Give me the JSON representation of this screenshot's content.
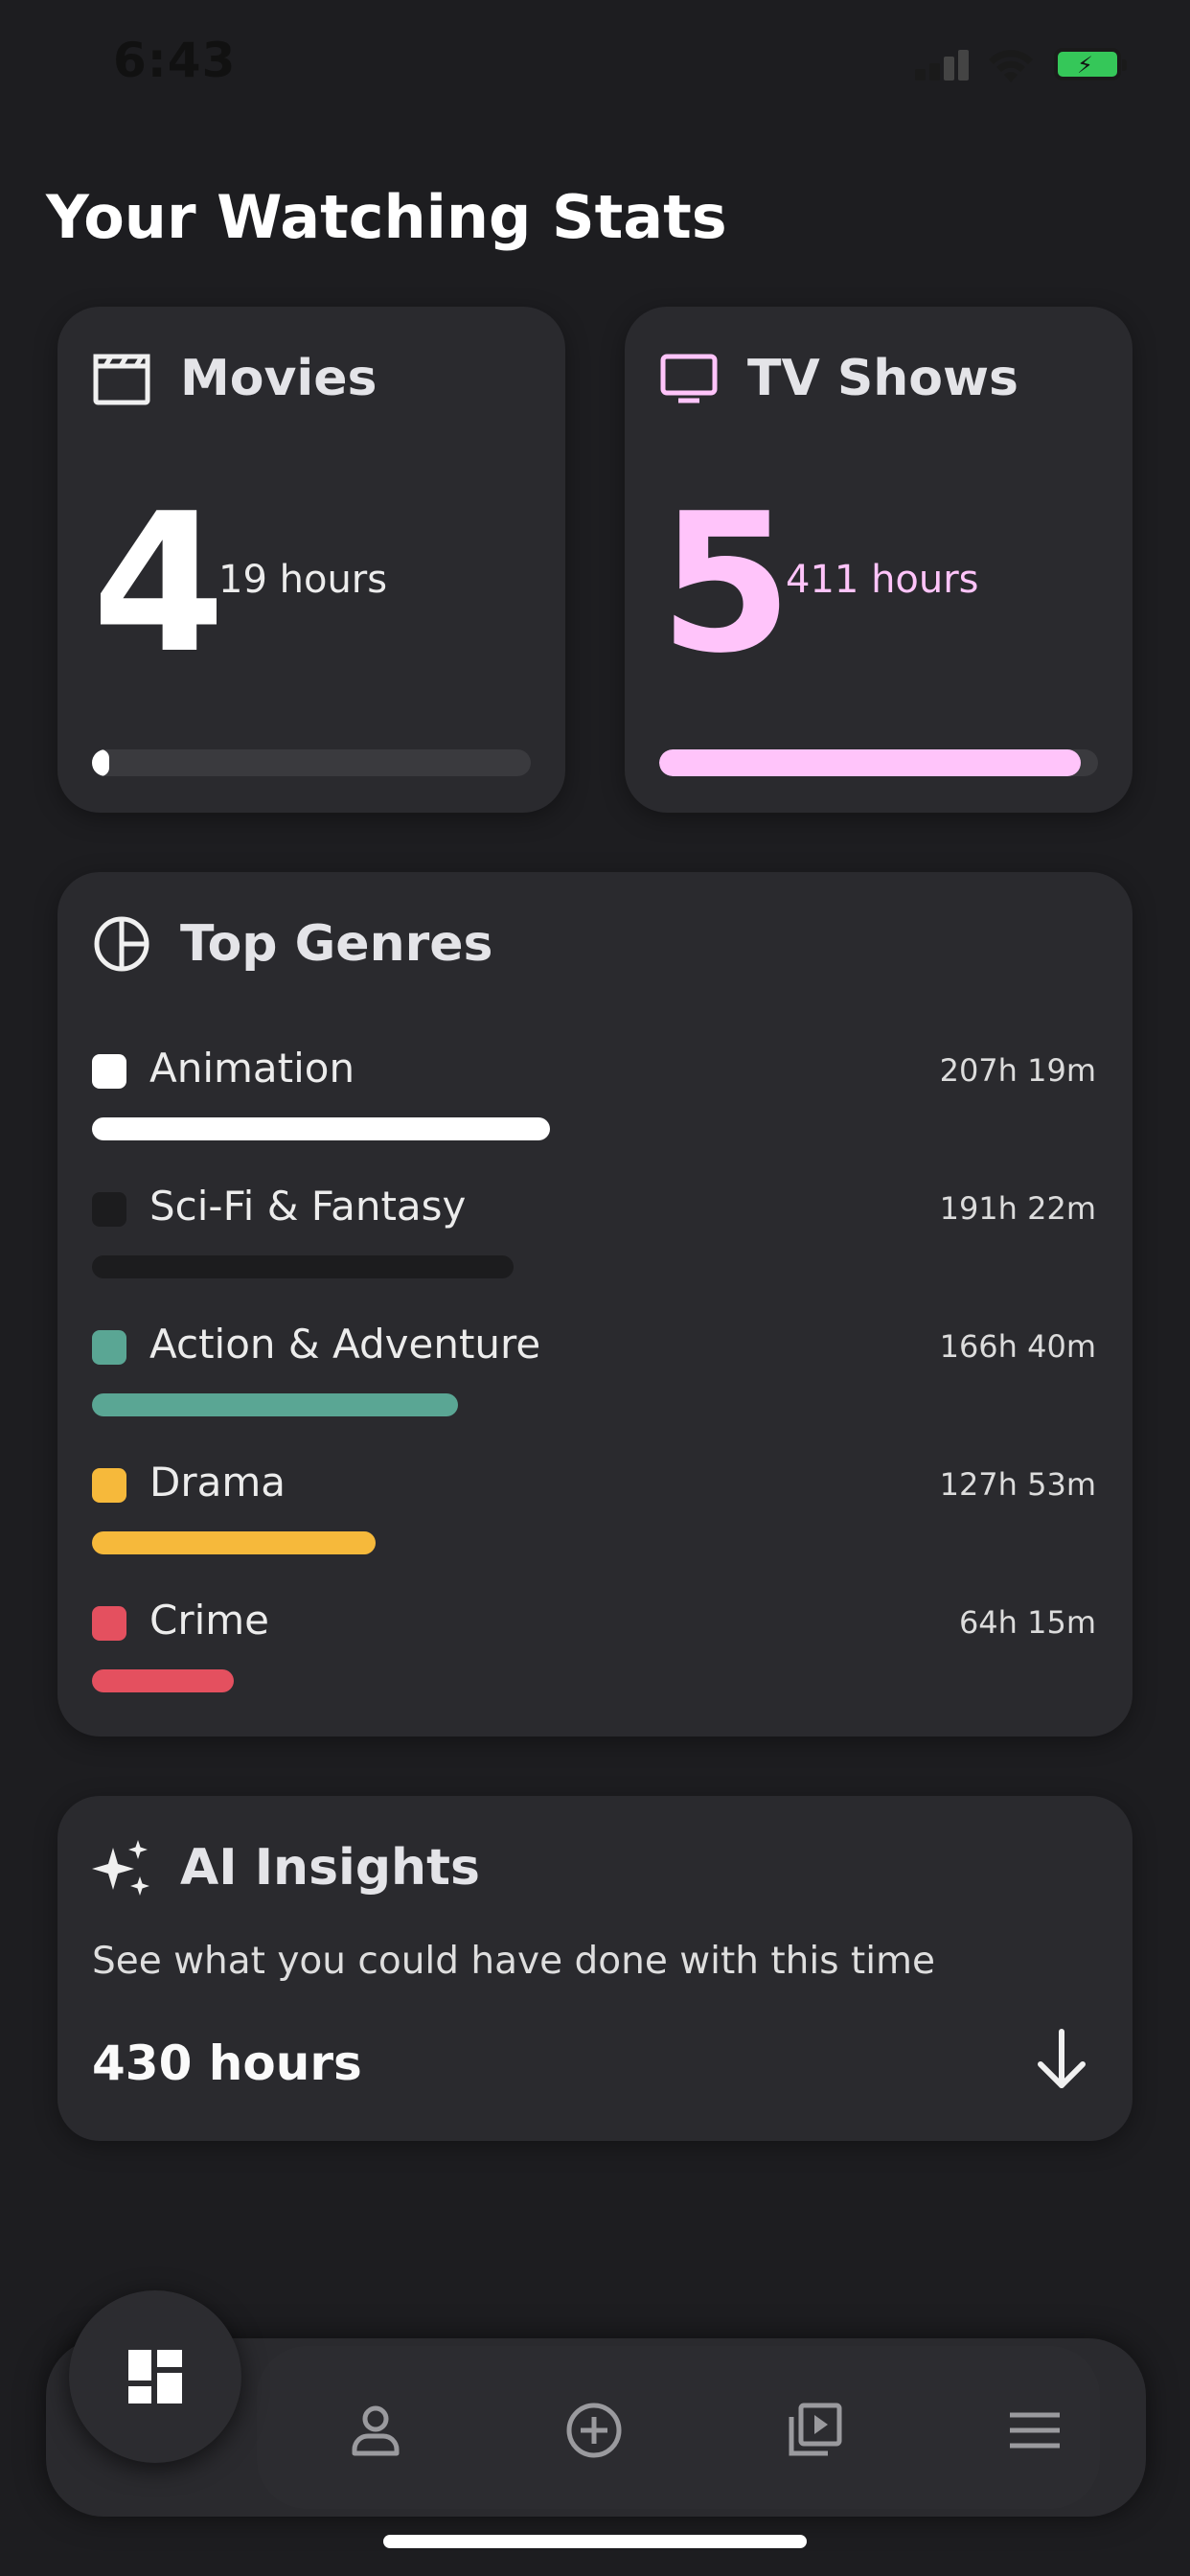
{
  "status_bar": {
    "time": "6:43"
  },
  "page_title": "Your Watching Stats",
  "movies": {
    "label": "Movies",
    "count": "4",
    "hours": "19 hours",
    "progress": 0.04,
    "color": "#ffffff"
  },
  "tv_shows": {
    "label": "TV Shows",
    "count": "5",
    "hours": "411 hours",
    "progress": 0.96,
    "color": "#ffc4fa"
  },
  "top_genres": {
    "title": "Top Genres",
    "items": [
      {
        "name": "Animation",
        "time": "207h 19m",
        "color": "#ffffff",
        "share": 1.0
      },
      {
        "name": "Sci-Fi & Fantasy",
        "time": "191h 22m",
        "color": "#1c1c1e",
        "share": 0.92
      },
      {
        "name": "Action & Adventure",
        "time": "166h 40m",
        "color": "#5aa694",
        "share": 0.8
      },
      {
        "name": "Drama",
        "time": "127h 53m",
        "color": "#f6b93b",
        "share": 0.62
      },
      {
        "name": "Crime",
        "time": "64h 15m",
        "color": "#e4505f",
        "share": 0.31
      }
    ]
  },
  "ai_insights": {
    "title": "AI Insights",
    "description": "See what you could have done with this time",
    "total": "430 hours"
  },
  "nav": {
    "items": [
      "dashboard-icon",
      "profile-icon",
      "add-icon",
      "library-icon",
      "menu-icon"
    ],
    "active": "dashboard-icon"
  }
}
